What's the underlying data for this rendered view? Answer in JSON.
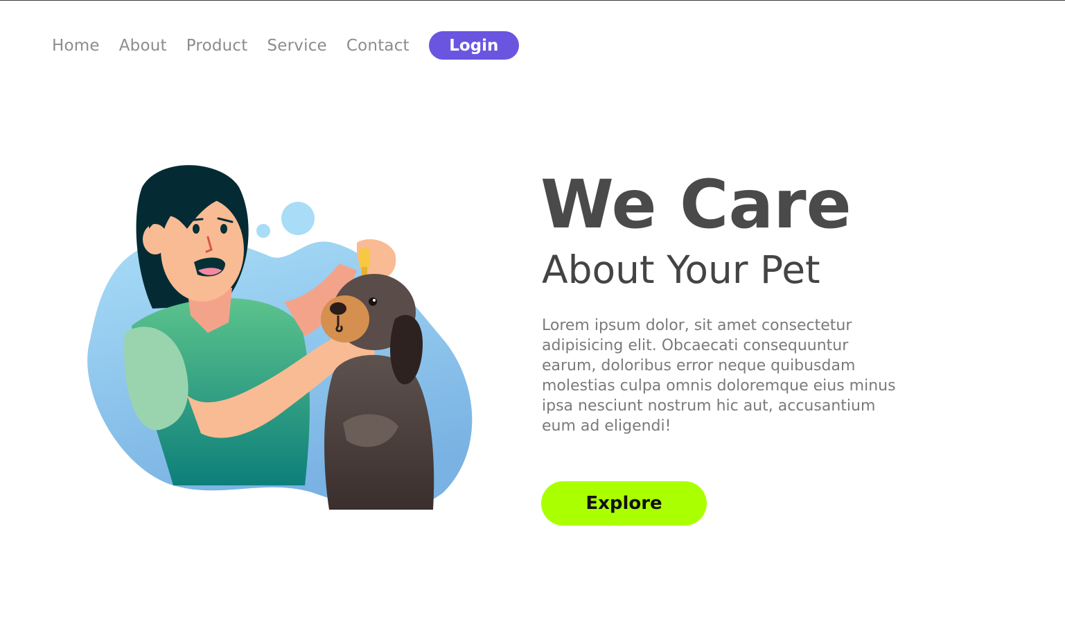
{
  "nav": {
    "links": [
      {
        "label": "Home"
      },
      {
        "label": "About"
      },
      {
        "label": "Product"
      },
      {
        "label": "Service"
      },
      {
        "label": "Contact"
      }
    ],
    "login_label": "Login"
  },
  "hero": {
    "title": "We Care",
    "subtitle": "About Your Pet",
    "body": "Lorem ipsum dolor, sit amet consectetur adipisicing elit. Obcaecati consequuntur earum, doloribus error neque quibusdam molestias culpa omnis doloremque eius minus ipsa nesciunt nostrum hic aut, accusantium eum ad eligendi!",
    "cta_label": "Explore"
  },
  "colors": {
    "accent": "#6a55e0",
    "cta": "#aaff00",
    "heading": "#4a4a4a",
    "body_text": "#7a7a7a",
    "nav_text": "#8c8c8c"
  },
  "illustration": {
    "subject": "woman giving eye drops to dog"
  }
}
